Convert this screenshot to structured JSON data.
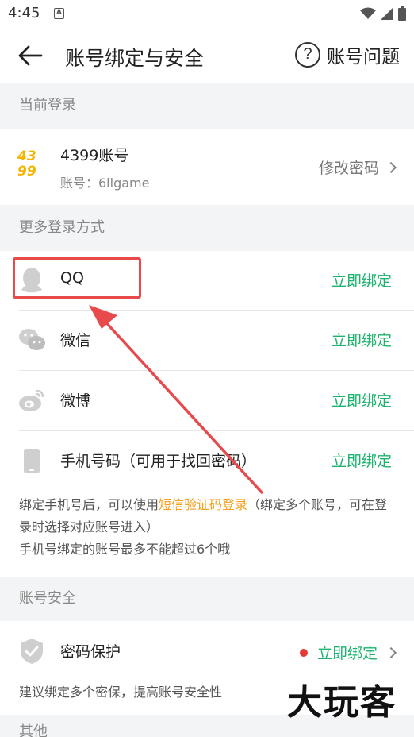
{
  "status_bar": {
    "time": "4:45",
    "badge": "A"
  },
  "header": {
    "title": "账号绑定与安全",
    "help_label": "账号问题",
    "help_glyph": "?"
  },
  "current_login": {
    "section_title": "当前登录",
    "account_name": "4399账号",
    "account_sub": "账号：6llgame",
    "logo_top": "43",
    "logo_bottom": "99",
    "action": "修改密码"
  },
  "more_login": {
    "section_title": "更多登录方式",
    "items": [
      {
        "label": "QQ",
        "action": "立即绑定",
        "icon": "qq-icon"
      },
      {
        "label": "微信",
        "action": "立即绑定",
        "icon": "wechat-icon"
      },
      {
        "label": "微博",
        "action": "立即绑定",
        "icon": "weibo-icon"
      },
      {
        "label": "手机号码（可用于找回密码）",
        "action": "立即绑定",
        "icon": "phone-icon"
      }
    ],
    "note_prefix": "绑定手机号后，可以使用",
    "note_highlight": "短信验证码登录",
    "note_suffix": "（绑定多个账号，可在登录时选择对应账号进入）",
    "note_line2": "手机号绑定的账号最多不能超过6个哦"
  },
  "account_security": {
    "section_title": "账号安全",
    "item_label": "密码保护",
    "item_action": "立即绑定",
    "note": "建议绑定多个密保，提高账号安全性"
  },
  "other": {
    "section_title": "其他"
  },
  "watermark": "大玩客",
  "colors": {
    "accent_green": "#1bb36d",
    "highlight_orange": "#f5a01c",
    "annotation_red": "#e8494b"
  }
}
